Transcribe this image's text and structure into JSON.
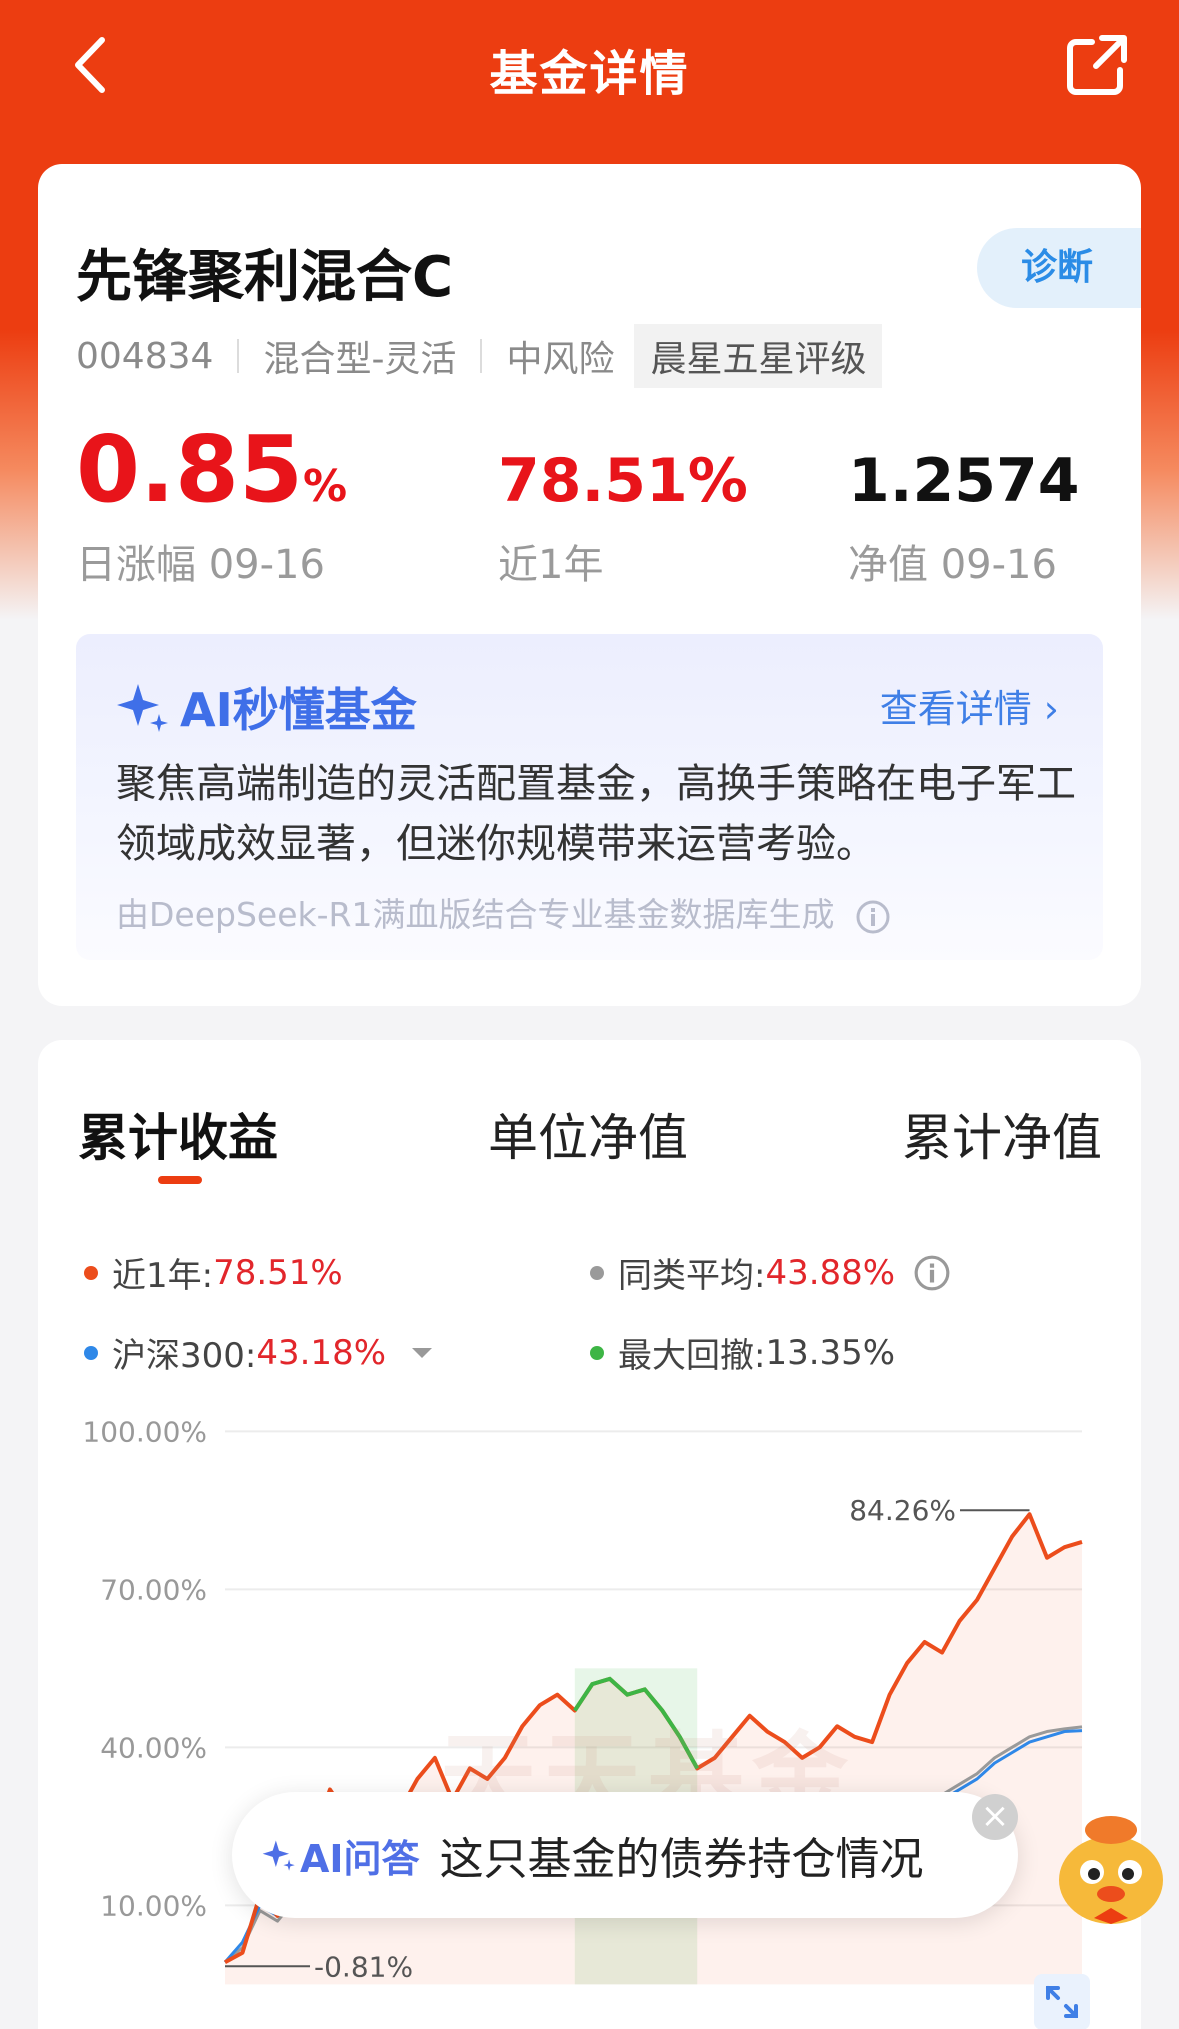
{
  "nav": {
    "title": "基金详情"
  },
  "fund": {
    "name": "先锋聚利混合C",
    "diagnose_label": "诊断",
    "code": "004834",
    "type": "混合型-灵活",
    "risk": "中风险",
    "rating": "晨星五星评级",
    "daily_change": "0.85",
    "daily_change_unit": "%",
    "daily_change_label": "日涨幅 09-16",
    "year_return": "78.51%",
    "year_return_label": "近1年",
    "nav": "1.2574",
    "nav_label": "净值 09-16"
  },
  "ai_card": {
    "title": "AI秒懂基金",
    "more": "查看详情",
    "summary": "聚焦高端制造的灵活配置基金，高换手策略在电子军工领域成效显著，但迷你规模带来运营考验。",
    "source": "由DeepSeek-R1满血版结合专业基金数据库生成"
  },
  "tabs": [
    {
      "label": "累计收益",
      "active": true
    },
    {
      "label": "单位净值",
      "active": false
    },
    {
      "label": "累计净值",
      "active": false
    }
  ],
  "legend": {
    "fund": {
      "label": "近1年:",
      "value": "78.51%",
      "color": "#ec4d1c"
    },
    "peer": {
      "label": "同类平均:",
      "value": "43.88%",
      "color": "#9a9a9a"
    },
    "index": {
      "label": "沪深300:",
      "value": "43.18%",
      "color": "#2f88e8"
    },
    "drawdown": {
      "label": "最大回撤:",
      "value": "13.35%",
      "color": "#3db545"
    }
  },
  "chart_data": {
    "type": "line",
    "y_ticks": [
      "100.00%",
      "70.00%",
      "40.00%",
      "10.00%"
    ],
    "ylim": [
      -5,
      100
    ],
    "annotations": {
      "max": "84.26%",
      "min": "-0.81%"
    },
    "series": [
      {
        "name": "近1年",
        "color": "#ec4d1c",
        "values": [
          -0.81,
          1,
          12,
          8,
          20,
          22,
          32,
          27,
          25,
          30,
          28,
          34,
          38,
          30,
          36,
          34,
          38,
          44,
          48,
          50,
          47,
          52,
          53,
          50,
          51,
          47,
          42,
          36,
          38,
          42,
          46,
          43,
          41,
          38,
          40,
          44,
          42,
          41,
          50,
          56,
          60,
          58,
          64,
          68,
          74,
          80,
          84.26,
          76,
          78,
          79
        ]
      },
      {
        "name": "沪深300",
        "color": "#2f88e8",
        "values": [
          -0.81,
          3,
          10,
          8,
          12,
          13,
          15,
          14,
          13,
          14,
          15,
          17,
          18,
          16,
          18,
          17,
          18,
          20,
          21,
          22,
          21,
          22,
          23,
          22,
          22,
          20,
          18,
          16,
          17,
          18,
          19,
          18,
          18,
          17,
          18,
          19,
          19,
          19,
          23,
          26,
          29,
          30,
          32,
          34,
          37,
          39,
          41,
          42,
          43,
          43.18
        ]
      },
      {
        "name": "同类平均",
        "color": "#9a9a9a",
        "values": [
          -0.81,
          2,
          9,
          7,
          11,
          12,
          14,
          13,
          13,
          14,
          15,
          16,
          17,
          16,
          17,
          17,
          18,
          19,
          20,
          21,
          20,
          21,
          22,
          21,
          21,
          20,
          18,
          17,
          18,
          19,
          20,
          19,
          19,
          18,
          19,
          20,
          20,
          20,
          24,
          27,
          30,
          31,
          33,
          35,
          38,
          40,
          42,
          43,
          43.5,
          43.88
        ]
      }
    ],
    "drawdown_range_index": [
      20,
      27
    ]
  },
  "chart_popup": {
    "label": "AI问答",
    "question": "这只基金的债券持仓情况"
  },
  "watermark": "天天基金"
}
